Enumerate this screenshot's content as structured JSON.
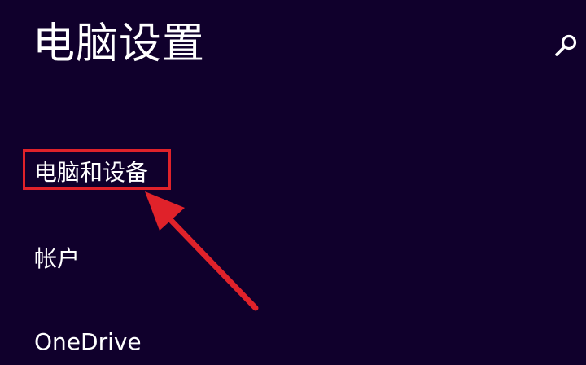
{
  "header": {
    "title": "电脑设置",
    "search_icon": "search-icon"
  },
  "nav": {
    "items": [
      {
        "label": "电脑和设备"
      },
      {
        "label": "帐户"
      },
      {
        "label": "OneDrive"
      }
    ]
  },
  "annotation": {
    "color": "#e0222a",
    "highlighted_item": "电脑和设备"
  },
  "theme": {
    "background": "#10002c",
    "text": "#ffffff"
  }
}
